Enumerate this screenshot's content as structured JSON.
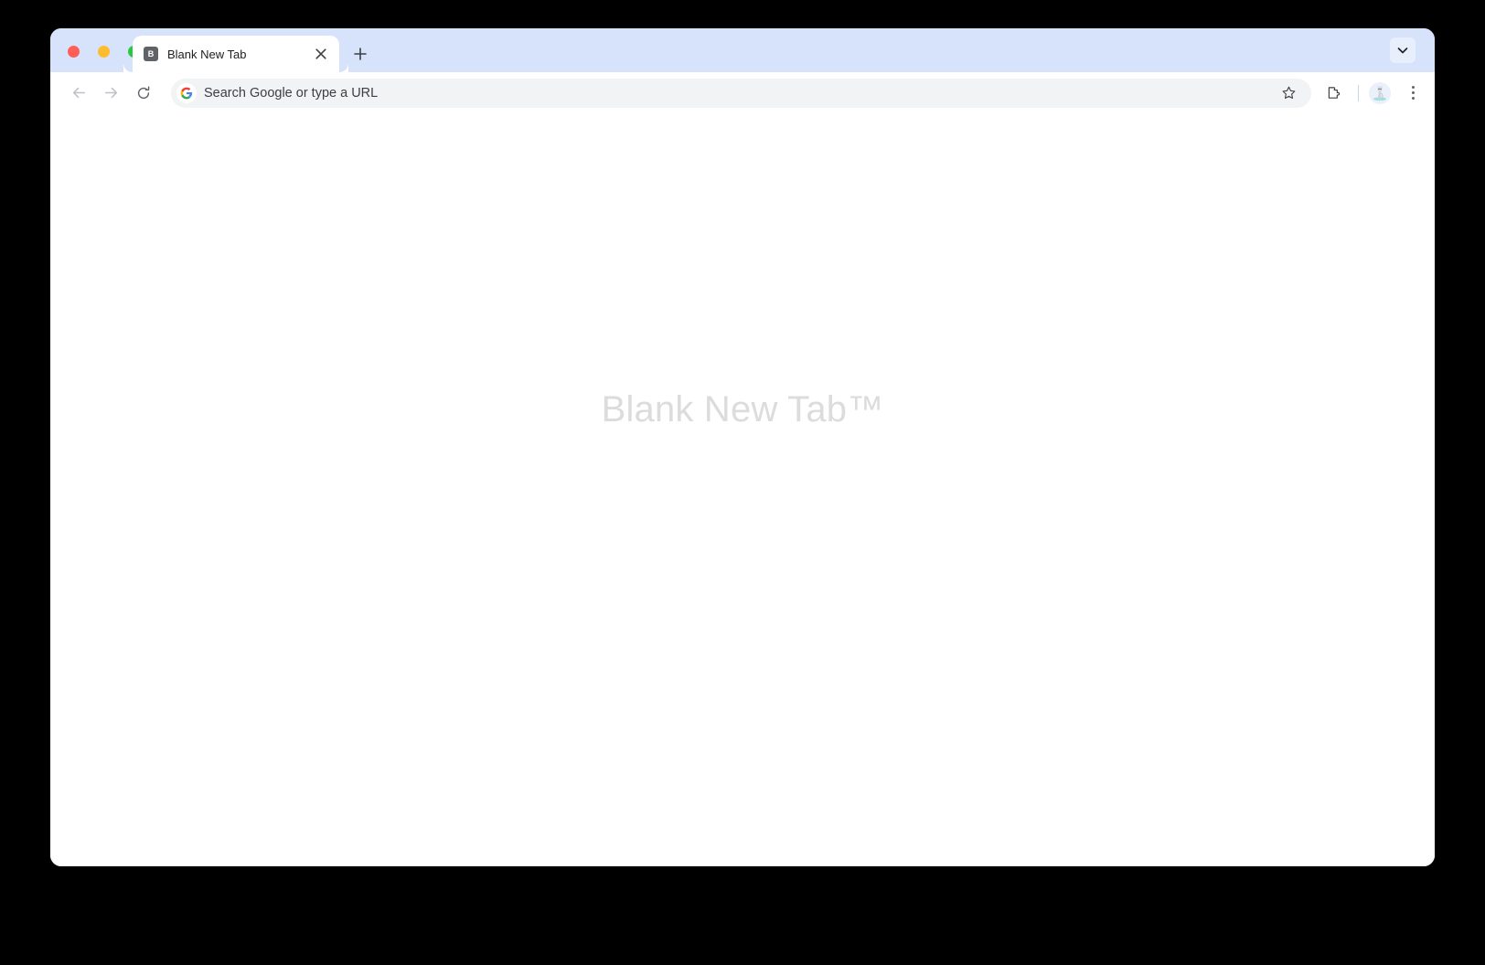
{
  "window": {
    "traffic_lights": [
      {
        "name": "close",
        "color": "#ff5f57"
      },
      {
        "name": "minimize",
        "color": "#febc2e"
      },
      {
        "name": "maximize",
        "color": "#28c840"
      }
    ]
  },
  "tabstrip": {
    "background_color": "#d7e3fb",
    "tabs": [
      {
        "title": "Blank New Tab",
        "favicon_letter": "B",
        "favicon_bg": "#5f6368",
        "active": true,
        "close_icon": "close-icon"
      }
    ],
    "new_tab_icon": "plus-icon",
    "new_tab_label": "+",
    "tab_search_icon": "chevron-down-icon"
  },
  "toolbar": {
    "back_icon": "arrow-left-icon",
    "forward_icon": "arrow-right-icon",
    "reload_icon": "reload-icon",
    "omnibox": {
      "placeholder": "Search Google or type a URL",
      "value": "",
      "leading_icon": "google-g-icon",
      "background_color": "#f1f3f4"
    },
    "bookmark_icon": "star-icon",
    "extensions_icon": "puzzle-piece-icon",
    "avatar_icon": "profile-avatar-icon",
    "menu_icon": "three-dot-menu-icon"
  },
  "content": {
    "heading": "Blank New Tab™",
    "heading_color": "#dcdcdc",
    "background_color": "#ffffff"
  }
}
